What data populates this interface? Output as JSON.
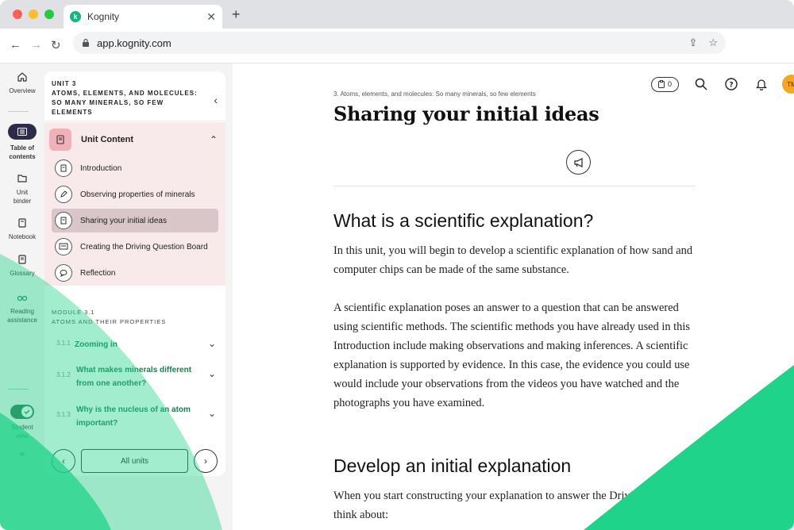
{
  "browser": {
    "tab_title": "Kognity",
    "tab_favicon": "kognity-logo",
    "url": "app.kognity.com",
    "colors": {
      "red": "#ff5f57",
      "yellow": "#febc2e",
      "green": "#28c840"
    }
  },
  "rail": {
    "items": [
      {
        "label": "Overview",
        "icon": "home-icon"
      },
      {
        "label": "Table of contents",
        "icon": "list-icon",
        "active": true
      },
      {
        "label": "Unit binder",
        "icon": "folder-icon"
      },
      {
        "label": "Notebook",
        "icon": "notebook-icon"
      },
      {
        "label": "Glossary",
        "icon": "book-icon"
      },
      {
        "label": "Reading assistance",
        "icon": "glasses-icon"
      }
    ],
    "student_view_label": "Student view",
    "collapse_icon": "double-chevron-left-icon"
  },
  "toc": {
    "unit_number": "UNIT 3",
    "unit_title": "ATOMS, ELEMENTS, AND MOLECULES: SO MANY MINERALS, SO FEW ELEMENTS",
    "unit_content_label": "Unit Content",
    "lessons": [
      {
        "label": "Introduction",
        "icon": "book-icon"
      },
      {
        "label": "Observing properties of minerals",
        "icon": "pencil-icon"
      },
      {
        "label": "Sharing your initial ideas",
        "icon": "book-icon",
        "active": true
      },
      {
        "label": "Creating the Driving Question Board",
        "icon": "board-icon"
      },
      {
        "label": "Reflection",
        "icon": "speech-bubble-icon"
      }
    ],
    "module_number": "MODULE 3.1",
    "module_title": "ATOMS AND THEIR PROPERTIES",
    "subsections": [
      {
        "num": "3.1.1",
        "label": "Zooming in"
      },
      {
        "num": "3.1.2",
        "label": "What makes minerals different from one another?"
      },
      {
        "num": "3.1.3",
        "label": "Why is the nucleus of an atom important?"
      }
    ],
    "all_units_label": "All units"
  },
  "header": {
    "clipboard_count": "0",
    "avatar_initials": "TM",
    "avatar_color": "#f5a623"
  },
  "article": {
    "breadcrumb": "3. Atoms, elements, and molecules: So many minerals, so few elements",
    "title": "Sharing your initial ideas",
    "section1_heading": "What is a scientific explanation?",
    "para1": "In this unit, you will begin to develop a scientific explanation of how sand and computer chips can be made of the same substance.",
    "para2": "A scientific explanation poses an answer to a question that can be answered using scientific methods. The scientific methods you have already used in this Introduction include making observations and making inferences. A scientific explanation is supported by evidence. In this case, the evidence you could use would include your observations from the videos you have watched and the photographs you have examined.",
    "section2_heading": "Develop an initial explanation",
    "para3": "When you start constructing your explanation to answer the Driving Question, think about:"
  },
  "accent_green": "#1fd38a"
}
